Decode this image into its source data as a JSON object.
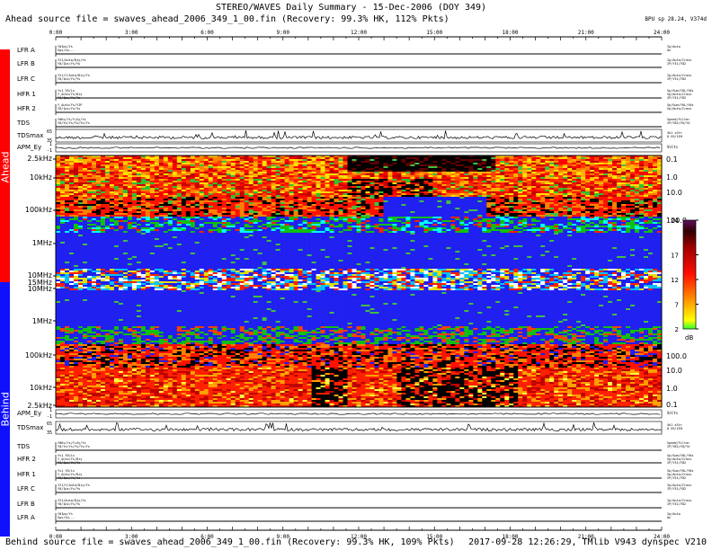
{
  "title": "STEREO/WAVES Daily Summary - 15-Dec-2006 (DOY 349)",
  "ahead_source": "Ahead source file = swaves_ahead_2006_349_1_00.fin (Recovery: 99.3% HK, 112% Pkts)",
  "behind_source": "Behind source file = swaves_ahead_2006_349_1_00.fin (Recovery: 99.3% HK, 109% Pkts)",
  "footer": "2017-09-28 12:26:29, TMlib V943 dynspec V210",
  "bpu": "BPU sp 28.24, V374d",
  "side_labels": {
    "ahead": "Ahead",
    "behind": "Behind"
  },
  "colors": {
    "ahead": "#ff0000",
    "behind": "#1010ff"
  },
  "chart_data": {
    "type": "heatmap",
    "x_ticks": [
      "0:00",
      "3:00",
      "6:00",
      "9:00",
      "12:00",
      "15:00",
      "18:00",
      "21:00",
      "24:00"
    ],
    "xlim": [
      0,
      24
    ],
    "y_ticks_ahead": [
      "2.5kHz",
      "10kHz",
      "100kHz",
      "1MHz",
      "10MHz"
    ],
    "y_ticks_mid": [
      "15MHz"
    ],
    "y_ticks_behind": [
      "10MHz",
      "1MHz",
      "100kHz",
      "10kHz",
      "2.5kHz"
    ],
    "right_ticks_ahead": [
      "0.1",
      "1.0",
      "10.0",
      "100.0"
    ],
    "right_ticks_behind": [
      "100.0",
      "10.0",
      "1.0",
      "0.1"
    ],
    "colorbar": {
      "ticks": [
        "24",
        "17",
        "12",
        "7",
        "2"
      ],
      "unit": "dB",
      "range": [
        2,
        24
      ]
    },
    "ahead_panels": [
      {
        "label": "LFR A",
        "left": [
          "Y0Ips/Ys",
          "Sps/Ia---"
        ],
        "right": [
          "Ip/Auto",
          "On"
        ]
      },
      {
        "label": "LFR B",
        "left": [
          "Y21/Auto/Diy/Ys",
          "Y0/Ips/Ys/Ys"
        ],
        "right": [
          "Ip/Auto/Cross",
          "IP/Y31/Y82"
        ]
      },
      {
        "label": "LFR C",
        "left": [
          "Y21/Y/Auto/Diy/Ys",
          "Y0/Ips/Ys/Ys"
        ],
        "right": [
          "Ip/Auto/Cross",
          "IP/Y31/Y82"
        ]
      },
      {
        "label": "HFR 1",
        "left": [
          "Ys1_Y0/Ls",
          "Y_Auto/Ys/Diy",
          "Y0/Ips/Ys/Ys"
        ],
        "right": [
          "Sp/Sum/Y0L/Y0s",
          "Sp/Auto/Cross",
          "IP/Y31/Y82"
        ]
      },
      {
        "label": "HFR 2",
        "left": [
          "Y_Auto/Ys/YIP",
          "Y0/Ips/Ys/Ys"
        ],
        "right": [
          "Sp/Sum/Y0L/Y0s",
          "Sp/Auto/Cross"
        ]
      },
      {
        "label": "TDS",
        "left": [
          "Y0Ks/Ys/Y+Sy/Ys",
          "Y0/Ys/Ys/Ys/Ys/Ys"
        ],
        "right": [
          "Speed/Filter",
          "IP/Y82/Y0/Y4"
        ]
      }
    ],
    "ahead_tdsmax": {
      "label": "TDSmax",
      "ticks": [
        "65",
        "35"
      ],
      "right": [
        "4k1 sStr",
        "0.55/1EH"
      ]
    },
    "ahead_apm": {
      "label": "APM_Ey",
      "ticks": [
        "1",
        "-1"
      ],
      "right": [
        "Volts"
      ]
    },
    "behind_apm": {
      "label": "APM_Ey",
      "ticks": [
        "1",
        "-1"
      ],
      "right": [
        "Volts"
      ]
    },
    "behind_tdsmax": {
      "label": "TDSmax",
      "ticks": [
        "65",
        "35"
      ],
      "right": [
        "4k1 sStr",
        "0.55/1EH"
      ]
    },
    "behind_panels": [
      {
        "label": "TDS",
        "left": [
          "Y0Ks/Ys/Y+Sy/Ys",
          "Y0/Ys/Ys/Ys/Ys/Ys"
        ],
        "right": [
          "Speed/Filter",
          "IP/Y82/Y0/Y4"
        ]
      },
      {
        "label": "HFR 2",
        "left": [
          "Ys1_Y0/Ls",
          "Y_Auto/Ys/Diy",
          "Y0/Ips/Ys/Ys"
        ],
        "right": [
          "Sp/Sum/Y0L/Y0s",
          "Sp/Auto/Cross",
          "IP/Y31/Y82"
        ]
      },
      {
        "label": "HFR 1",
        "left": [
          "Ys1_Y0/Ls",
          "Y_Auto/Ys/Diy",
          "Y0/Ips/Ys/Ys"
        ],
        "right": [
          "Sp/Sum/Y0L/Y0s",
          "Sp/Auto/Cross",
          "IP/Y31/Y82"
        ]
      },
      {
        "label": "LFR C",
        "left": [
          "Y21/Y/Auto/Diy/Ys",
          "Y0/Ips/Ys/Ys"
        ],
        "right": [
          "Ip/Auto/Cross",
          "IP/Y31/Y82"
        ]
      },
      {
        "label": "LFR B",
        "left": [
          "Y21/Auto/Diy/Ys",
          "Y0/Ips/Ys/Ys"
        ],
        "right": [
          "Ip/Auto/Cross",
          "IP/Y31/Y82"
        ]
      },
      {
        "label": "LFR A",
        "left": [
          "Y0Ips/Ys",
          "Sps/Ia---"
        ],
        "right": [
          "Ip/Auto",
          "On"
        ]
      }
    ]
  }
}
